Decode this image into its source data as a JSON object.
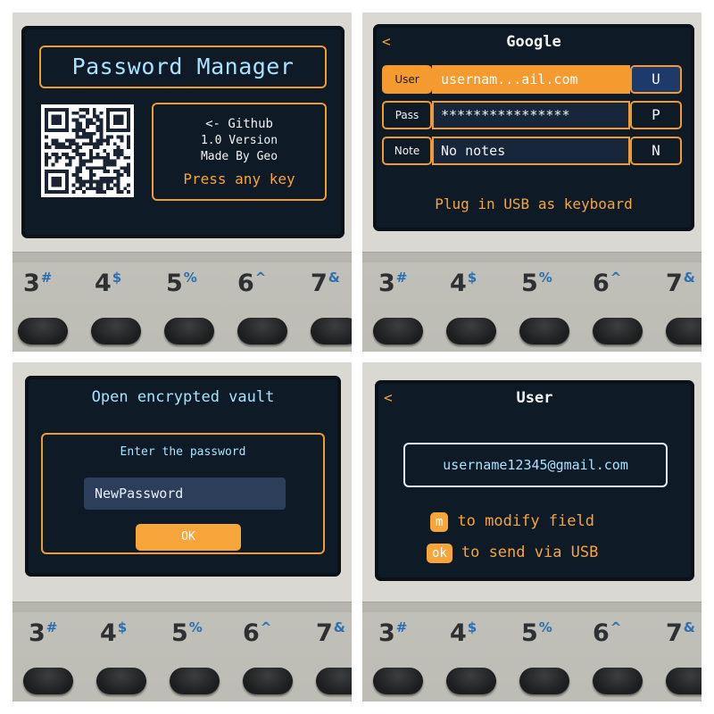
{
  "keyboard": {
    "keys": [
      {
        "num": "3",
        "sym": "#"
      },
      {
        "num": "4",
        "sym": "$"
      },
      {
        "num": "5",
        "sym": "%"
      },
      {
        "num": "6",
        "sym": "^"
      },
      {
        "num": "7",
        "sym": "&"
      }
    ]
  },
  "splash": {
    "title": "Password Manager",
    "link": "<- Github",
    "version": "1.0 Version",
    "author": "Made By Geo",
    "prompt": "Press any key"
  },
  "entry": {
    "back": "<",
    "title": "Google",
    "fields": [
      {
        "label": "User",
        "value": "usernam...ail.com",
        "key": "U"
      },
      {
        "label": "Pass",
        "value": "****************",
        "key": "P"
      },
      {
        "label": "Note",
        "value": "No notes",
        "key": "N"
      }
    ],
    "hint": "Plug in USB as keyboard"
  },
  "vault": {
    "title": "Open encrypted vault",
    "prompt": "Enter the password",
    "password": "NewPassword",
    "ok": "OK"
  },
  "field_view": {
    "back": "<",
    "title": "User",
    "value": "username12345@gmail.com",
    "hint_modify_key": "m",
    "hint_modify": "to modify field",
    "hint_send_key": "ok",
    "hint_send": "to send via USB"
  },
  "colors": {
    "screen": "#0f1a27",
    "accent_orange": "#f5a53a",
    "text_cyan": "#a8e3ff",
    "key_symbol_blue": "#2a6fb3"
  }
}
